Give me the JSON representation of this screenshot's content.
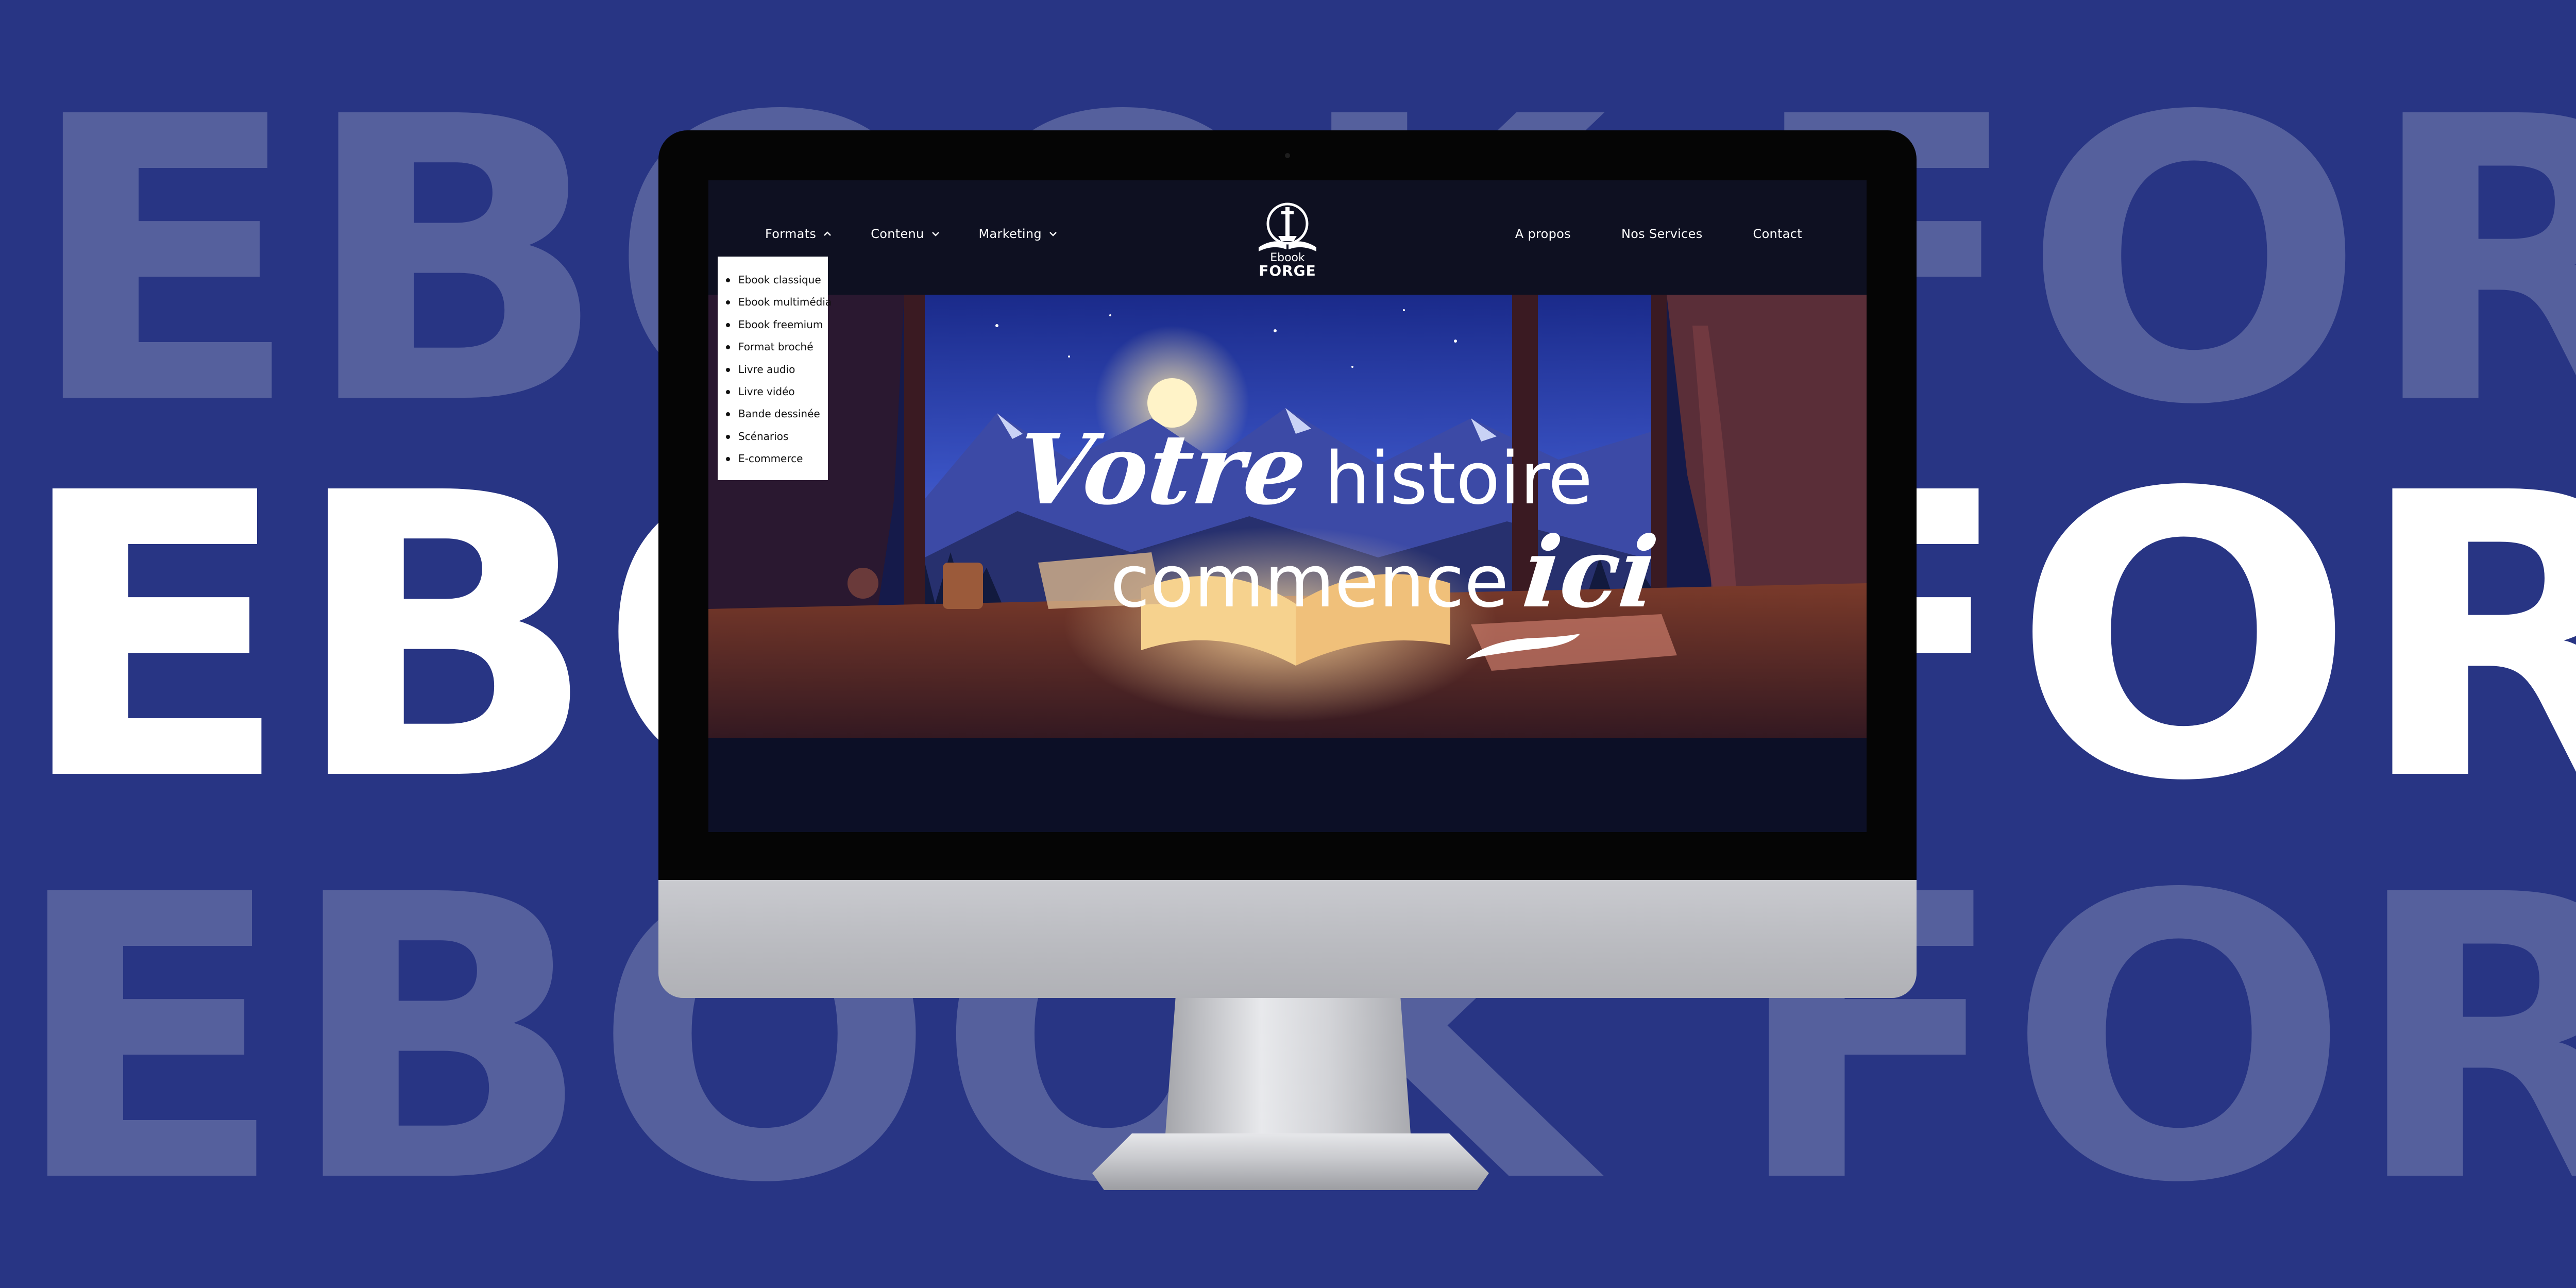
{
  "background": {
    "words": [
      "EBOOK FORGE",
      "EBOOK FORGE",
      "EBOOK FORGE"
    ],
    "color": "#283584"
  },
  "nav": {
    "left_items": [
      {
        "label": "Formats",
        "icon": "chevron-up-icon"
      },
      {
        "label": "Contenu",
        "icon": "chevron-down-icon"
      },
      {
        "label": "Marketing",
        "icon": "chevron-down-icon"
      }
    ],
    "logo": {
      "line1": "Ebook",
      "line2": "FORGE"
    },
    "right_items": [
      "A propos",
      "Nos Services",
      "Contact"
    ]
  },
  "formats_dropdown": [
    "Ebook classique",
    "Ebook multimédia",
    "Ebook freemium",
    "Format broché",
    "Livre audio",
    "Livre vidéo",
    "Bande dessinée",
    "Scénarios",
    "E-commerce"
  ],
  "hero": {
    "word1": "Votre",
    "word2": "histoire",
    "word3": "commence",
    "word4": "ici"
  }
}
